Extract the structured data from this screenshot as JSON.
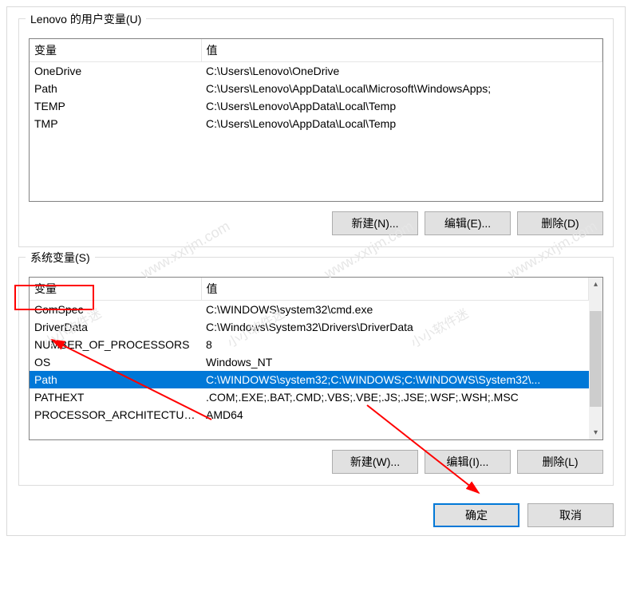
{
  "user_vars": {
    "label": "Lenovo 的用户变量(U)",
    "columns": {
      "var": "变量",
      "val": "值"
    },
    "rows": [
      {
        "var": "OneDrive",
        "val": "C:\\Users\\Lenovo\\OneDrive"
      },
      {
        "var": "Path",
        "val": "C:\\Users\\Lenovo\\AppData\\Local\\Microsoft\\WindowsApps;"
      },
      {
        "var": "TEMP",
        "val": "C:\\Users\\Lenovo\\AppData\\Local\\Temp"
      },
      {
        "var": "TMP",
        "val": "C:\\Users\\Lenovo\\AppData\\Local\\Temp"
      }
    ],
    "buttons": {
      "new": "新建(N)...",
      "edit": "编辑(E)...",
      "delete": "删除(D)"
    }
  },
  "sys_vars": {
    "label": "系统变量(S)",
    "columns": {
      "var": "变量",
      "val": "值"
    },
    "rows": [
      {
        "var": "ComSpec",
        "val": "C:\\WINDOWS\\system32\\cmd.exe"
      },
      {
        "var": "DriverData",
        "val": "C:\\Windows\\System32\\Drivers\\DriverData"
      },
      {
        "var": "NUMBER_OF_PROCESSORS",
        "val": "8"
      },
      {
        "var": "OS",
        "val": "Windows_NT"
      },
      {
        "var": "Path",
        "val": "C:\\WINDOWS\\system32;C:\\WINDOWS;C:\\WINDOWS\\System32\\..."
      },
      {
        "var": "PATHEXT",
        "val": ".COM;.EXE;.BAT;.CMD;.VBS;.VBE;.JS;.JSE;.WSF;.WSH;.MSC"
      },
      {
        "var": "PROCESSOR_ARCHITECTURE",
        "val": "AMD64"
      }
    ],
    "selected_index": 4,
    "buttons": {
      "new": "新建(W)...",
      "edit": "编辑(I)...",
      "delete": "删除(L)"
    }
  },
  "dialog_buttons": {
    "ok": "确定",
    "cancel": "取消"
  },
  "watermark": {
    "text1": "www.xxrjm.com",
    "text2": "小小软件迷"
  }
}
